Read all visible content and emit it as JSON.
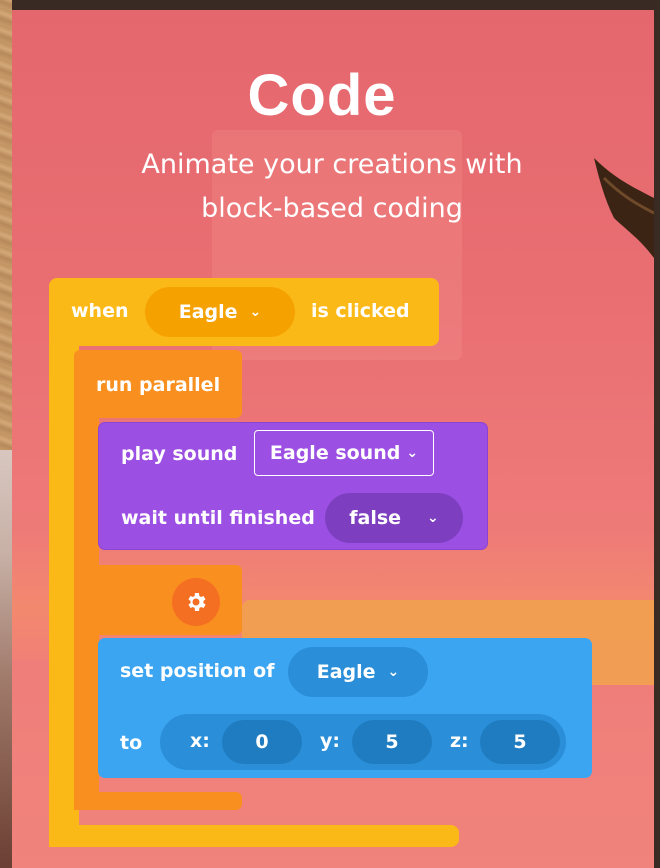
{
  "header": {
    "title": "Code",
    "subtitle_line1": "Animate your creations with",
    "subtitle_line2": "block-based coding"
  },
  "blocks": {
    "when": {
      "prefix": "when",
      "object": "Eagle",
      "suffix": "is clicked"
    },
    "run_parallel": {
      "label": "run parallel"
    },
    "play_sound": {
      "label": "play sound",
      "sound": "Eagle sound",
      "wait_label": "wait until finished",
      "wait_value": "false"
    },
    "set_position": {
      "label": "set position of",
      "object": "Eagle",
      "to_label": "to",
      "x_label": "x:",
      "x": "0",
      "y_label": "y:",
      "y": "5",
      "z_label": "z:",
      "z": "5"
    }
  },
  "icons": {
    "dropdown": "chevron-down-icon",
    "settings": "gear-icon"
  },
  "colors": {
    "background": "#e96f73",
    "event_block": "#fbb917",
    "control_block": "#f98f1f",
    "sound_block": "#9c4fe3",
    "motion_block": "#3ba5f2"
  }
}
